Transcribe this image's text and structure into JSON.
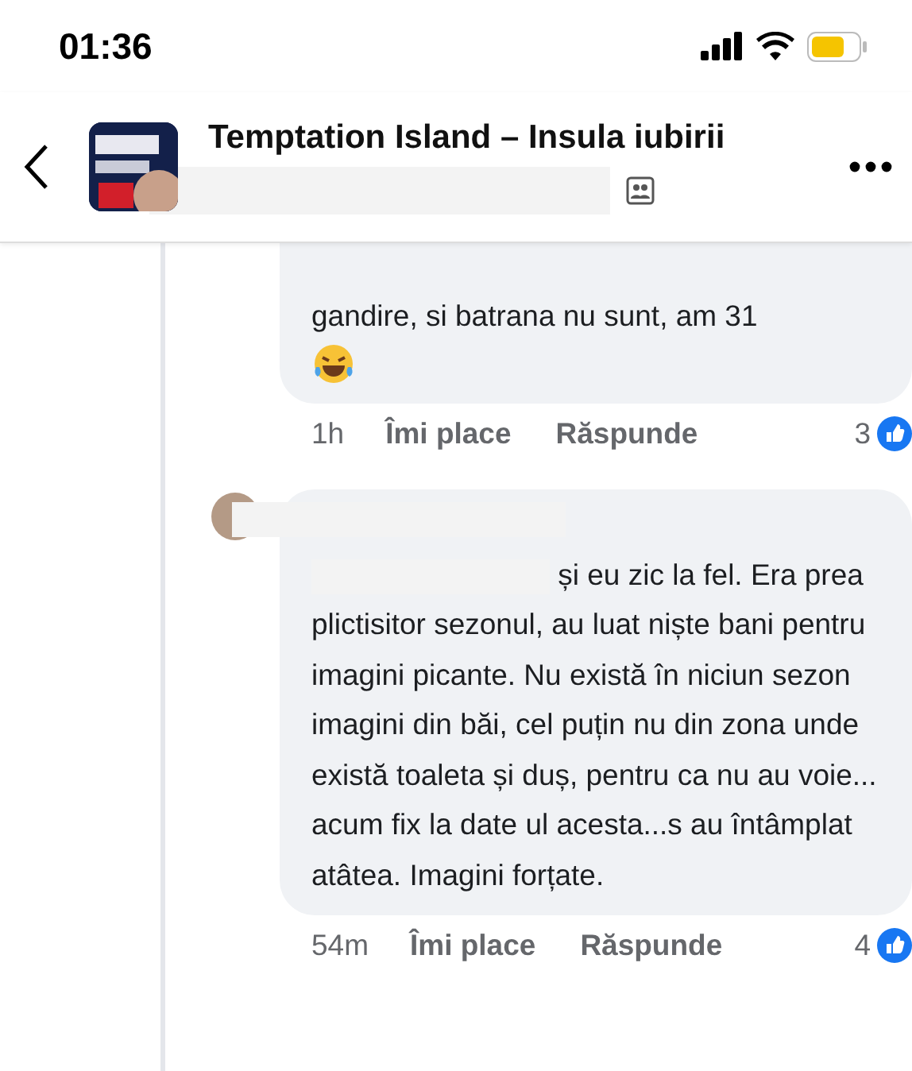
{
  "status_bar": {
    "time": "01:36"
  },
  "header": {
    "title": "Temptation Island – Insula iubirii"
  },
  "comments": [
    {
      "text": "gandire, si batrana nu sunt, am 31",
      "emoji": true,
      "time": "1h",
      "like": "Îmi place",
      "reply": "Răspunde",
      "count": "3"
    },
    {
      "text": "și eu zic la fel. Era prea plictisitor sezonul, au luat niște bani pentru imagini picante. Nu există în niciun sezon imagini din băi, cel puțin nu din zona unde există toaleta și duș, pentru ca nu au voie... acum fix la date ul acesta...s au întâmplat atâtea. Imagini forțate.",
      "time": "54m",
      "like": "Îmi place",
      "reply": "Răspunde",
      "count": "4"
    }
  ]
}
